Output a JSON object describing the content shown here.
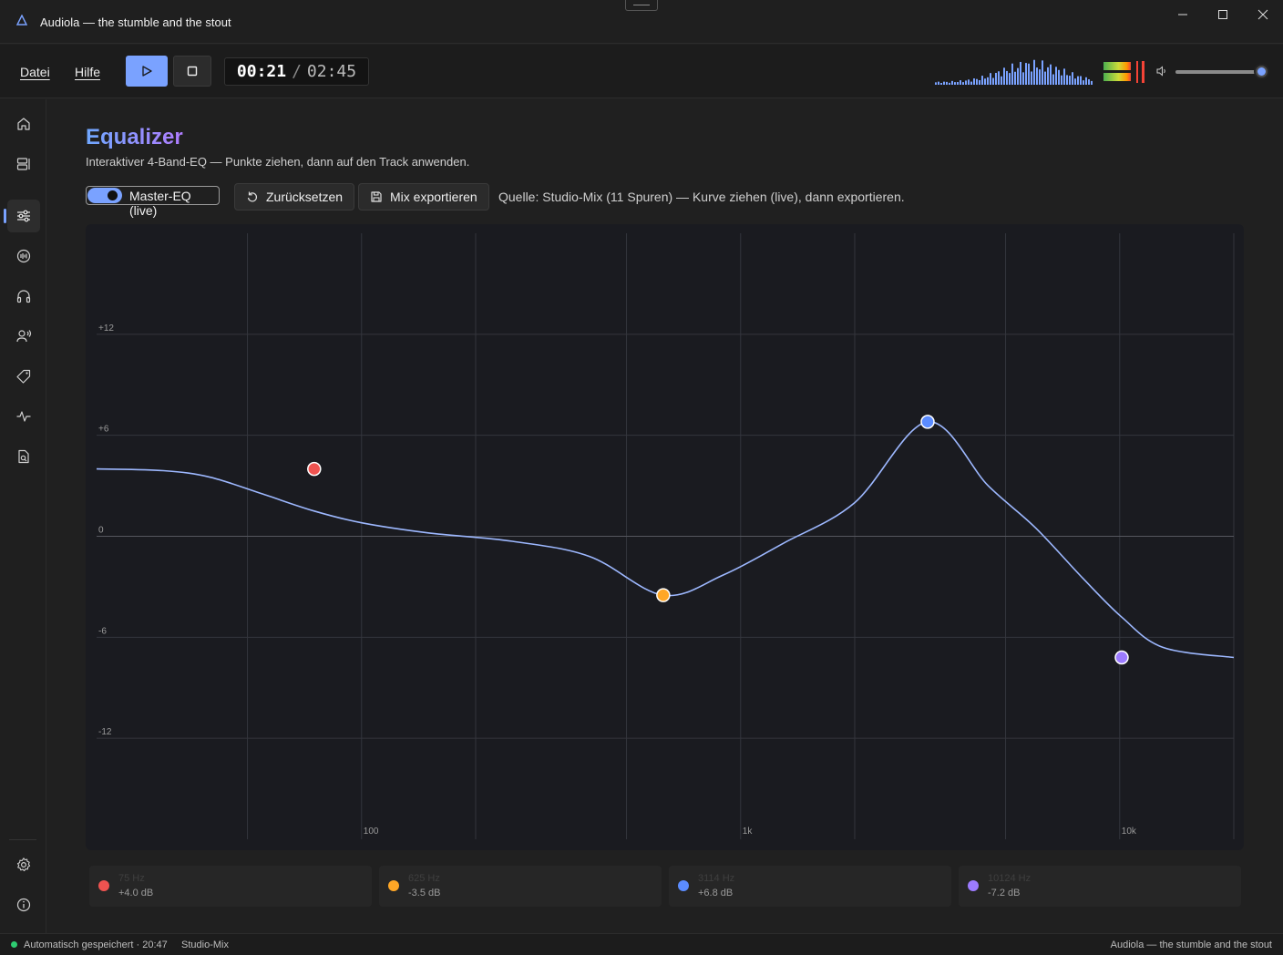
{
  "window": {
    "title": "Audiola — the stumble and the stout"
  },
  "menu": {
    "file": "Datei",
    "help": "Hilfe"
  },
  "transport": {
    "current": "00:21",
    "separator": "/",
    "total": "02:45"
  },
  "volume": {
    "level": 0.9
  },
  "sidebar": {
    "items": [
      {
        "icon": "home-icon"
      },
      {
        "icon": "library-icon"
      },
      {
        "icon": "equalizer-icon",
        "active": true
      },
      {
        "icon": "audio-icon"
      },
      {
        "icon": "headphones-icon"
      },
      {
        "icon": "voice-icon"
      },
      {
        "icon": "tag-icon"
      },
      {
        "icon": "waveform-icon"
      },
      {
        "icon": "document-search-icon"
      }
    ],
    "bottom": [
      {
        "icon": "gear-icon"
      },
      {
        "icon": "info-icon"
      }
    ]
  },
  "page": {
    "title": "Equalizer",
    "subtitle": "Interaktiver 4-Band-EQ — Punkte ziehen, dann auf den Track anwenden.",
    "toggle_label": "Master-EQ (live)",
    "toggle_on": true,
    "reset_label": "Zurücksetzen",
    "export_label": "Mix exportieren",
    "source_text": "Quelle: Studio-Mix (11 Spuren) — Kurve ziehen (live), dann exportieren."
  },
  "chart_data": {
    "type": "line",
    "x_scale": "log",
    "xlim": [
      20,
      20000
    ],
    "ylim": [
      -18,
      18
    ],
    "y_ticks": [
      12,
      6,
      0,
      -6,
      -12
    ],
    "y_tick_labels": [
      "+12",
      "+6",
      "0",
      "-6",
      "-12"
    ],
    "x_ticks": [
      100,
      1000,
      10000
    ],
    "x_tick_labels": [
      "100",
      "1k",
      "10k"
    ],
    "grid": true,
    "curve": {
      "x": [
        20,
        30,
        40,
        55,
        75,
        100,
        150,
        250,
        400,
        625,
        900,
        1300,
        2000,
        3114,
        4500,
        6000,
        8000,
        10124,
        13000,
        20000
      ],
      "y": [
        4.0,
        3.9,
        3.5,
        2.5,
        1.5,
        0.8,
        0.2,
        -0.3,
        -1.2,
        -3.5,
        -2.3,
        -0.4,
        2.0,
        6.8,
        3.0,
        0.5,
        -2.5,
        -4.8,
        -6.6,
        -7.2
      ]
    },
    "points": [
      {
        "freq": 75,
        "gain": 4.0,
        "color": "#ef5350"
      },
      {
        "freq": 625,
        "gain": -3.5,
        "color": "#ffa726"
      },
      {
        "freq": 3114,
        "gain": 6.8,
        "color": "#5b8cff"
      },
      {
        "freq": 10124,
        "gain": -7.2,
        "color": "#9c7bff"
      }
    ],
    "curve_color": "#9db8ff"
  },
  "bands": [
    {
      "freq": "75 Hz",
      "gain": "+4.0 dB",
      "color": "#ef5350"
    },
    {
      "freq": "625 Hz",
      "gain": "-3.5 dB",
      "color": "#ffa726"
    },
    {
      "freq": "3114 Hz",
      "gain": "+6.8 dB",
      "color": "#5b8cff"
    },
    {
      "freq": "10124 Hz",
      "gain": "-7.2 dB",
      "color": "#9c7bff"
    }
  ],
  "status": {
    "saved": "Automatisch gespeichert · 20:47",
    "mix": "Studio-Mix",
    "right": "Audiola — the stumble and the stout"
  }
}
